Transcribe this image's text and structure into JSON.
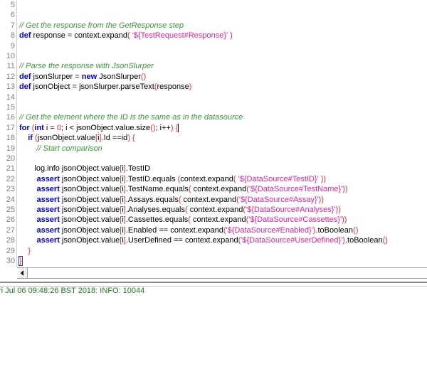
{
  "editor": {
    "lines": [
      {
        "num": "5",
        "tokens": []
      },
      {
        "num": "6",
        "tokens": []
      },
      {
        "num": "7",
        "tokens": [
          {
            "t": "c",
            "v": "// Get the response from the GetResponse step"
          }
        ]
      },
      {
        "num": "8",
        "tokens": [
          {
            "t": "k",
            "v": "def"
          },
          {
            "t": "t",
            "v": " response = context.expand"
          },
          {
            "t": "p",
            "v": "("
          },
          {
            "t": "s",
            "v": " '${TestRequest#Response}' "
          },
          {
            "t": "p",
            "v": ")"
          }
        ]
      },
      {
        "num": "9",
        "tokens": []
      },
      {
        "num": "10",
        "tokens": []
      },
      {
        "num": "11",
        "tokens": [
          {
            "t": "c",
            "v": "// Parse the response with JsonSlurper"
          }
        ]
      },
      {
        "num": "12",
        "tokens": [
          {
            "t": "k",
            "v": "def"
          },
          {
            "t": "t",
            "v": " jsonSlurper = "
          },
          {
            "t": "k",
            "v": "new"
          },
          {
            "t": "t",
            "v": " JsonSlurper"
          },
          {
            "t": "p",
            "v": "()"
          }
        ]
      },
      {
        "num": "13",
        "tokens": [
          {
            "t": "k",
            "v": "def"
          },
          {
            "t": "t",
            "v": " jsonObject = jsonSlurper.parseText"
          },
          {
            "t": "p",
            "v": "("
          },
          {
            "t": "t",
            "v": "response"
          },
          {
            "t": "p",
            "v": ")"
          }
        ]
      },
      {
        "num": "14",
        "tokens": []
      },
      {
        "num": "15",
        "tokens": []
      },
      {
        "num": "16",
        "tokens": [
          {
            "t": "c",
            "v": "// Get the element where the ID is the same as in the datasource"
          }
        ]
      },
      {
        "num": "17",
        "tokens": [
          {
            "t": "k",
            "v": "for"
          },
          {
            "t": "t",
            "v": " "
          },
          {
            "t": "p",
            "v": "("
          },
          {
            "t": "k",
            "v": "int"
          },
          {
            "t": "t",
            "v": " i = "
          },
          {
            "t": "p",
            "v": "0"
          },
          {
            "t": "t",
            "v": "; i < jsonObject.value.size"
          },
          {
            "t": "p",
            "v": "()"
          },
          {
            "t": "t",
            "v": "; i++"
          },
          {
            "t": "p",
            "v": ")"
          },
          {
            "t": "t",
            "v": " "
          },
          {
            "t": "p",
            "v": "{"
          }
        ],
        "cursor": true
      },
      {
        "num": "18",
        "tokens": [
          {
            "t": "t",
            "v": "    "
          },
          {
            "t": "k",
            "v": "if"
          },
          {
            "t": "t",
            "v": " "
          },
          {
            "t": "p",
            "v": "("
          },
          {
            "t": "t",
            "v": "jsonObject.value"
          },
          {
            "t": "p",
            "v": "["
          },
          {
            "t": "t",
            "v": "i"
          },
          {
            "t": "p",
            "v": "]"
          },
          {
            "t": "t",
            "v": ".Id ==id"
          },
          {
            "t": "p",
            "v": ")"
          },
          {
            "t": "t",
            "v": " "
          },
          {
            "t": "p",
            "v": "{"
          }
        ]
      },
      {
        "num": "19",
        "tokens": [
          {
            "t": "t",
            "v": "        "
          },
          {
            "t": "c",
            "v": "// Start comparison"
          }
        ]
      },
      {
        "num": "20",
        "tokens": []
      },
      {
        "num": "21",
        "tokens": [
          {
            "t": "t",
            "v": "       log.info jsonObject.value"
          },
          {
            "t": "p",
            "v": "["
          },
          {
            "t": "t",
            "v": "i"
          },
          {
            "t": "p",
            "v": "]"
          },
          {
            "t": "t",
            "v": ".TestID"
          }
        ]
      },
      {
        "num": "22",
        "tokens": [
          {
            "t": "t",
            "v": "        "
          },
          {
            "t": "k",
            "v": "assert"
          },
          {
            "t": "t",
            "v": " jsonObject.value"
          },
          {
            "t": "p",
            "v": "["
          },
          {
            "t": "t",
            "v": "i"
          },
          {
            "t": "p",
            "v": "]"
          },
          {
            "t": "t",
            "v": ".TestID.equals "
          },
          {
            "t": "p",
            "v": "("
          },
          {
            "t": "t",
            "v": "context.expand"
          },
          {
            "t": "p",
            "v": "("
          },
          {
            "t": "s",
            "v": " '${DataSource#TestID}' "
          },
          {
            "t": "p",
            "v": "))"
          }
        ]
      },
      {
        "num": "23",
        "tokens": [
          {
            "t": "t",
            "v": "        "
          },
          {
            "t": "k",
            "v": "assert"
          },
          {
            "t": "t",
            "v": " jsonObject.value"
          },
          {
            "t": "p",
            "v": "["
          },
          {
            "t": "t",
            "v": "i"
          },
          {
            "t": "p",
            "v": "]"
          },
          {
            "t": "t",
            "v": ".TestName.equals"
          },
          {
            "t": "p",
            "v": "("
          },
          {
            "t": "t",
            "v": " context.expand"
          },
          {
            "t": "p",
            "v": "("
          },
          {
            "t": "s",
            "v": "'${DataSource#TestName}'"
          },
          {
            "t": "p",
            "v": "))"
          }
        ]
      },
      {
        "num": "24",
        "tokens": [
          {
            "t": "t",
            "v": "        "
          },
          {
            "t": "k",
            "v": "assert"
          },
          {
            "t": "t",
            "v": " jsonObject.value"
          },
          {
            "t": "p",
            "v": "["
          },
          {
            "t": "t",
            "v": "i"
          },
          {
            "t": "p",
            "v": "]"
          },
          {
            "t": "t",
            "v": ".Assays.equals"
          },
          {
            "t": "p",
            "v": "("
          },
          {
            "t": "t",
            "v": " context.expand"
          },
          {
            "t": "p",
            "v": "("
          },
          {
            "t": "s",
            "v": "'${DataSource#Assay}'"
          },
          {
            "t": "p",
            "v": "))"
          }
        ]
      },
      {
        "num": "25",
        "tokens": [
          {
            "t": "t",
            "v": "        "
          },
          {
            "t": "k",
            "v": "assert"
          },
          {
            "t": "t",
            "v": " jsonObject.value"
          },
          {
            "t": "p",
            "v": "["
          },
          {
            "t": "t",
            "v": "i"
          },
          {
            "t": "p",
            "v": "]"
          },
          {
            "t": "t",
            "v": ".Analyses.equals"
          },
          {
            "t": "p",
            "v": "("
          },
          {
            "t": "t",
            "v": " context.expand"
          },
          {
            "t": "p",
            "v": "("
          },
          {
            "t": "s",
            "v": "'${DataSource#Analyses}'"
          },
          {
            "t": "p",
            "v": "))"
          }
        ]
      },
      {
        "num": "26",
        "tokens": [
          {
            "t": "t",
            "v": "        "
          },
          {
            "t": "k",
            "v": "assert"
          },
          {
            "t": "t",
            "v": " jsonObject.value"
          },
          {
            "t": "p",
            "v": "["
          },
          {
            "t": "t",
            "v": "i"
          },
          {
            "t": "p",
            "v": "]"
          },
          {
            "t": "t",
            "v": ".Cassettes.equals"
          },
          {
            "t": "p",
            "v": "("
          },
          {
            "t": "t",
            "v": " context.expand"
          },
          {
            "t": "p",
            "v": "("
          },
          {
            "t": "s",
            "v": "'${DataSource#Cassettes}'"
          },
          {
            "t": "p",
            "v": "))"
          }
        ]
      },
      {
        "num": "27",
        "tokens": [
          {
            "t": "t",
            "v": "        "
          },
          {
            "t": "k",
            "v": "assert"
          },
          {
            "t": "t",
            "v": " jsonObject.value"
          },
          {
            "t": "p",
            "v": "["
          },
          {
            "t": "t",
            "v": "i"
          },
          {
            "t": "p",
            "v": "]"
          },
          {
            "t": "t",
            "v": ".Enabled == context.expand"
          },
          {
            "t": "p",
            "v": "("
          },
          {
            "t": "s",
            "v": "'${DataSource#Enabled}'"
          },
          {
            "t": "p",
            "v": ")"
          },
          {
            "t": "t",
            "v": ".toBoolean"
          },
          {
            "t": "p",
            "v": "()"
          }
        ]
      },
      {
        "num": "28",
        "tokens": [
          {
            "t": "t",
            "v": "        "
          },
          {
            "t": "k",
            "v": "assert"
          },
          {
            "t": "t",
            "v": " jsonObject.value"
          },
          {
            "t": "p",
            "v": "["
          },
          {
            "t": "t",
            "v": "i"
          },
          {
            "t": "p",
            "v": "]"
          },
          {
            "t": "t",
            "v": ".UserDefined == context.expand"
          },
          {
            "t": "p",
            "v": "("
          },
          {
            "t": "s",
            "v": "'${DataSource#UserDefined}'"
          },
          {
            "t": "p",
            "v": ")"
          },
          {
            "t": "t",
            "v": ".toBoolean"
          },
          {
            "t": "p",
            "v": "()"
          }
        ]
      },
      {
        "num": "29",
        "tokens": [
          {
            "t": "t",
            "v": "    "
          },
          {
            "t": "p",
            "v": "}"
          }
        ]
      },
      {
        "num": "30",
        "tokens": [
          {
            "t": "p",
            "v": "}",
            "hl": true
          }
        ]
      }
    ]
  },
  "log": {
    "text": "ri Jul 06 09:48:26 BST 2018: INFO: 10044"
  }
}
